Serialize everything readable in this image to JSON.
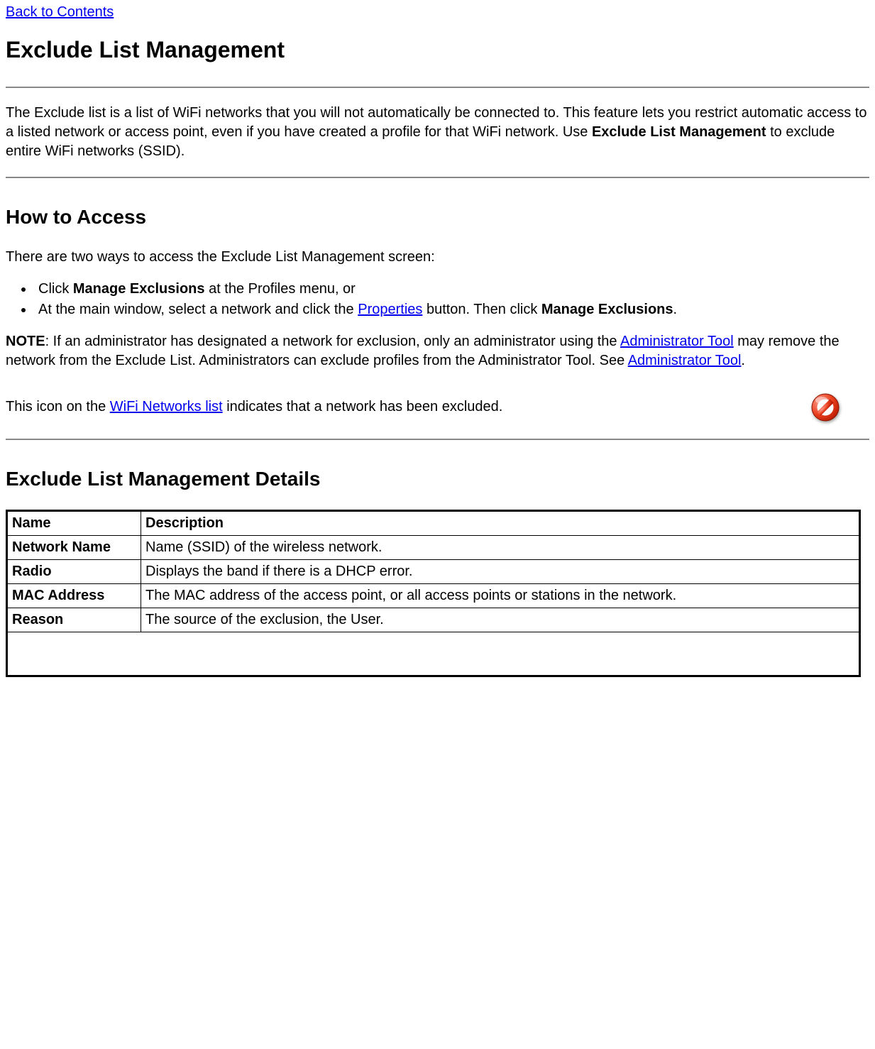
{
  "nav": {
    "back_to_contents": "Back to Contents"
  },
  "title": "Exclude List Management",
  "intro": {
    "before_bold": "The Exclude list is a list of WiFi networks that you will not automatically be connected to. This feature lets you restrict automatic access to a listed network or access point, even if you have created a profile for that WiFi network. Use ",
    "bold": "Exclude List Management",
    "after_bold": " to exclude entire WiFi networks (SSID)."
  },
  "how_to_access": {
    "heading": "How to Access",
    "lead": "There are two ways to access the Exclude List Management screen:",
    "bullet1": {
      "prefix": "Click ",
      "bold": "Manage Exclusions",
      "suffix": " at the Profiles menu, or"
    },
    "bullet2": {
      "prefix": "At the main window, select a network and click the ",
      "link": "Properties",
      "mid": " button. Then click ",
      "bold": "Manage Exclusions",
      "suffix": "."
    }
  },
  "note": {
    "label": "NOTE",
    "before_link1": ": If an administrator has designated a network for exclusion, only an administrator using the ",
    "link1": "Administrator Tool",
    "between": " may remove the network from the Exclude List. Administrators can exclude profiles from the Administrator Tool. See ",
    "link2": "Administrator Tool",
    "after": "."
  },
  "icon_sentence": {
    "before_link": "This icon on the ",
    "link": "WiFi Networks list",
    "after_link": " indicates that a network has been excluded."
  },
  "details": {
    "heading": "Exclude List Management Details",
    "columns": {
      "name": "Name",
      "description": "Description"
    },
    "rows": [
      {
        "name": "Network Name",
        "desc": "Name (SSID) of the wireless network."
      },
      {
        "name": "Radio",
        "desc": "Displays the band if there is a DHCP error."
      },
      {
        "name": "MAC Address",
        "desc": "The MAC address of the access point, or all access points or stations in the network."
      },
      {
        "name": "Reason",
        "desc": "The source of the exclusion, the User."
      }
    ]
  }
}
